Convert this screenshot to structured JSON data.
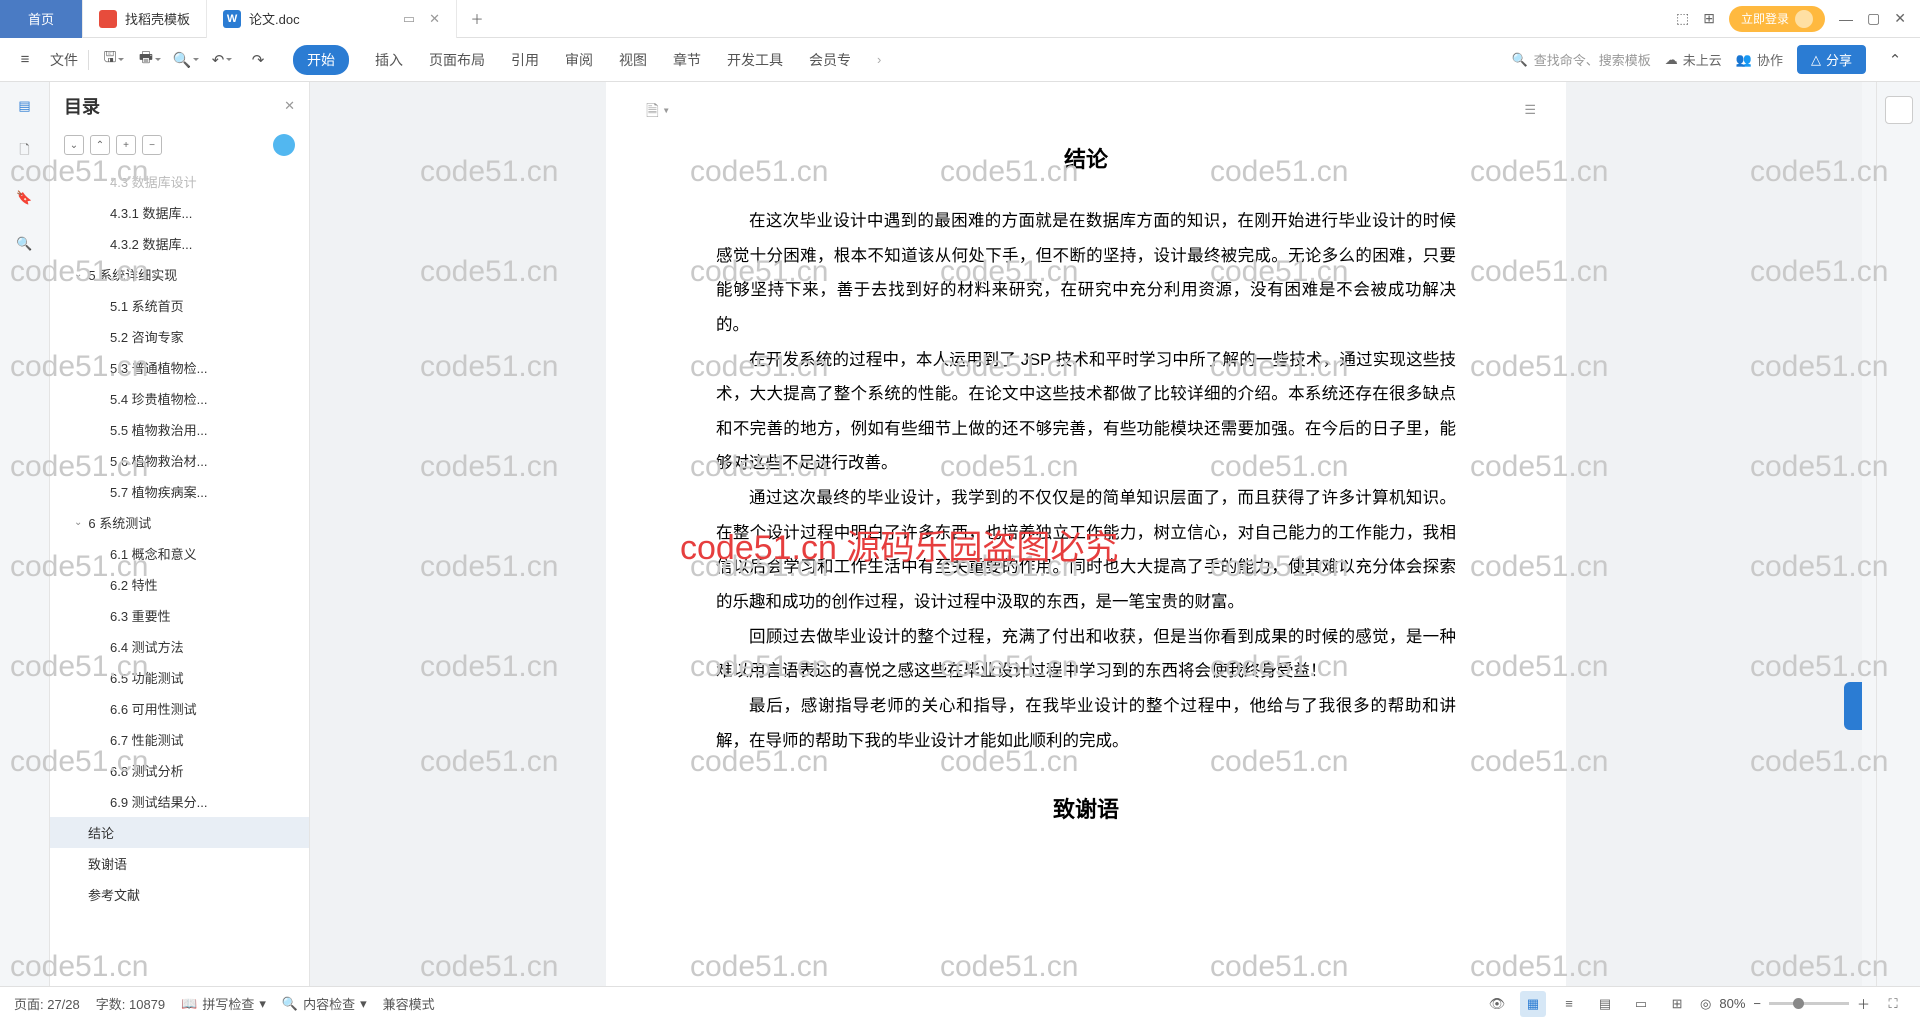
{
  "tabs": {
    "home": "首页",
    "template": "找稻壳模板",
    "doc": "论文.doc"
  },
  "login": "立即登录",
  "toolbar": {
    "file": "文件",
    "menu": [
      "开始",
      "插入",
      "页面布局",
      "引用",
      "审阅",
      "视图",
      "章节",
      "开发工具",
      "会员专"
    ],
    "search_placeholder": "查找命令、搜索模板",
    "cloud": "未上云",
    "collab": "协作",
    "share": "分享"
  },
  "outline": {
    "title": "目录",
    "items": [
      {
        "label": "4.3 数据库设计",
        "lvl": "l2 faded"
      },
      {
        "label": "4.3.1 数据库...",
        "lvl": "l3"
      },
      {
        "label": "4.3.2 数据库...",
        "lvl": "l3"
      },
      {
        "label": "5 系统详细实现",
        "lvl": "l1",
        "chev": true
      },
      {
        "label": "5.1 系统首页",
        "lvl": "l2"
      },
      {
        "label": "5.2 咨询专家",
        "lvl": "l2"
      },
      {
        "label": "5.3 普通植物检...",
        "lvl": "l2"
      },
      {
        "label": "5.4 珍贵植物检...",
        "lvl": "l2"
      },
      {
        "label": "5.5 植物救治用...",
        "lvl": "l2"
      },
      {
        "label": "5.6 植物救治材...",
        "lvl": "l2"
      },
      {
        "label": "5.7 植物疾病案...",
        "lvl": "l2"
      },
      {
        "label": "6 系统测试",
        "lvl": "l1",
        "chev": true
      },
      {
        "label": "6.1 概念和意义",
        "lvl": "l2"
      },
      {
        "label": "6.2 特性",
        "lvl": "l2"
      },
      {
        "label": "6.3 重要性",
        "lvl": "l2"
      },
      {
        "label": "6.4 测试方法",
        "lvl": "l2"
      },
      {
        "label": "6.5 功能测试",
        "lvl": "l2"
      },
      {
        "label": "6.6 可用性测试",
        "lvl": "l2"
      },
      {
        "label": "6.7 性能测试",
        "lvl": "l2"
      },
      {
        "label": "6.8 测试分析",
        "lvl": "l2"
      },
      {
        "label": "6.9 测试结果分...",
        "lvl": "l2"
      },
      {
        "label": "结论",
        "lvl": "t1",
        "active": true
      },
      {
        "label": "致谢语",
        "lvl": "t1"
      },
      {
        "label": "参考文献",
        "lvl": "t1"
      }
    ]
  },
  "document": {
    "heading1": "结论",
    "p1": "在这次毕业设计中遇到的最困难的方面就是在数据库方面的知识，在刚开始进行毕业设计的时候感觉十分困难，根本不知道该从何处下手，但不断的坚持，设计最终被完成。无论多么的困难，只要能够坚持下来，善于去找到好的材料来研究，在研究中充分利用资源，没有困难是不会被成功解决的。",
    "p2": "在开发系统的过程中，本人运用到了 JSP 技术和平时学习中所了解的一些技术，通过实现这些技术，大大提高了整个系统的性能。在论文中这些技术都做了比较详细的介绍。本系统还存在很多缺点和不完善的地方，例如有些细节上做的还不够完善，有些功能模块还需要加强。在今后的日子里，能够对这些不足进行改善。",
    "p3": "通过这次最终的毕业设计，我学到的不仅仅是的简单知识层面了，而且获得了许多计算机知识。在整个设计过程中明白了许多东西，也培养独立工作能力，树立信心，对自己能力的工作能力，我相信以后会学习和工作生活中有至关重要的作用。同时也大大提高了手的能力，使其难以充分体会探索的乐趣和成功的创作过程，设计过程中汲取的东西，是一笔宝贵的财富。",
    "p4": "回顾过去做毕业设计的整个过程，充满了付出和收获，但是当你看到成果的时候的感觉，是一种难以用言语表达的喜悦之感这些在毕业设计过程中学习到的东西将会使我终身受益！",
    "p5": "最后，感谢指导老师的关心和指导，在我毕业设计的整个过程中，他给与了我很多的帮助和讲解，在导师的帮助下我的毕业设计才能如此顺利的完成。",
    "heading2": "致谢语"
  },
  "status": {
    "page": "页面: 27/28",
    "words": "字数: 10879",
    "spellcheck": "拼写检查",
    "contentcheck": "内容检查",
    "compat": "兼容模式",
    "zoom": "80%"
  },
  "watermark_text": "code51.cn",
  "watermark_red": "code51.cn 源码乐园盗图必究"
}
